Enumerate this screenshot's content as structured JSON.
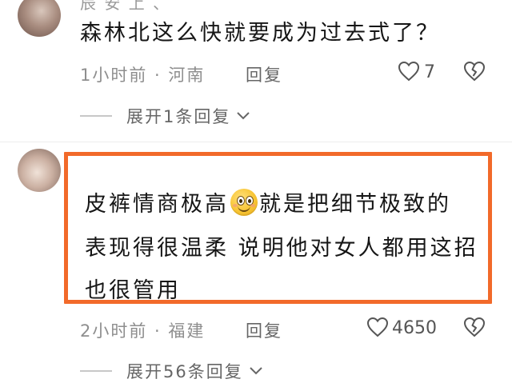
{
  "comment1": {
    "username": "辰 安 上 、",
    "text": "森林北这么快就要成为过去式了？",
    "time_location": "1小时前 · 河南",
    "reply_label": "回复",
    "like_count": "7",
    "expand_label": "展开1条回复"
  },
  "comment2": {
    "text_line1_a": "皮裤情商极高",
    "text_line1_b": "就是把细节极致的",
    "text_line2": "表现得很温柔  说明他对女人都用这招",
    "text_line3": "也很管用",
    "emoji_icon": "grinning-face-emoji",
    "time_location": "2小时前 · 福建",
    "reply_label": "回复",
    "like_count": "4650",
    "expand_label": "展开56条回复"
  },
  "colors": {
    "highlight_border": "#f26a2a",
    "meta_text": "#8e8e8e"
  }
}
